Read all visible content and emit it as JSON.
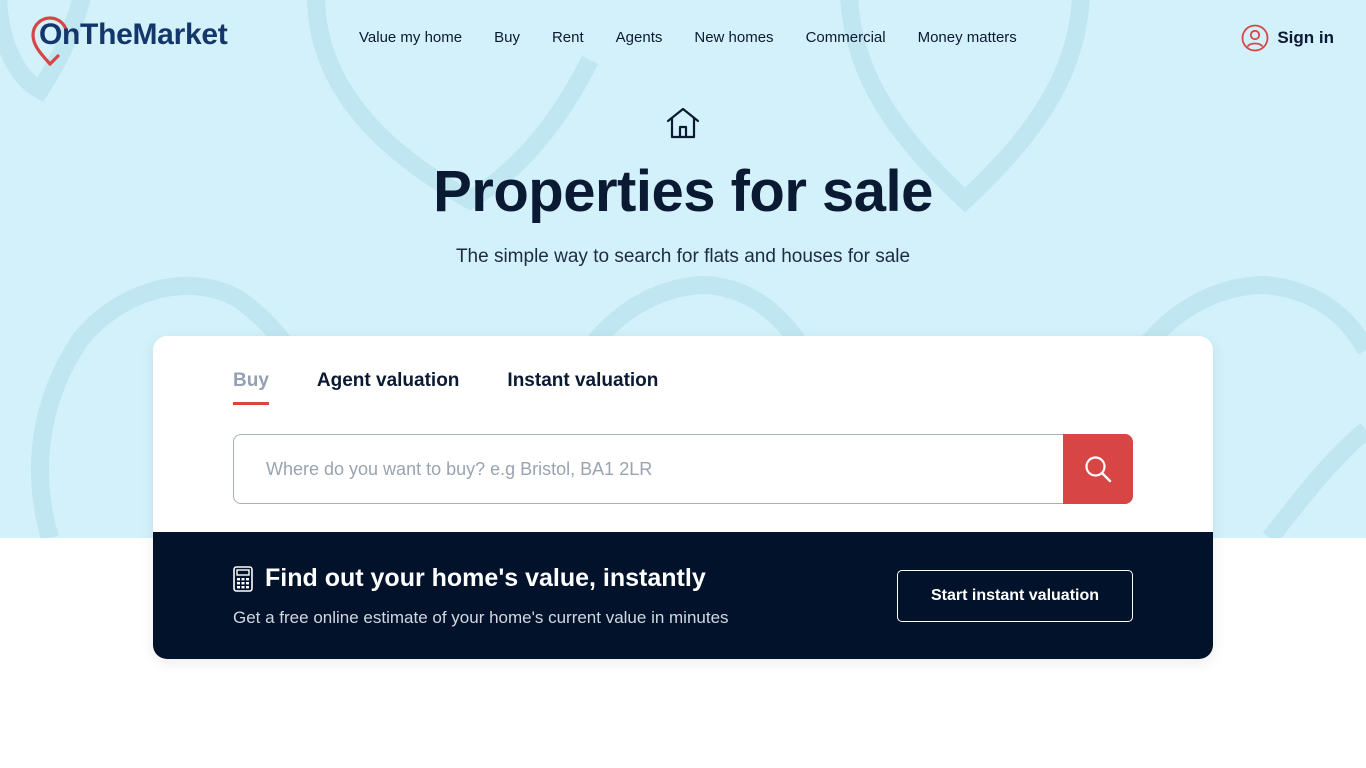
{
  "brand": {
    "name": "OnTheMarket",
    "accent_color": "#d74544",
    "navy_color": "#0b1a33",
    "hero_bg_color": "#d3f1fa",
    "logo_text_color": "#13366b"
  },
  "nav": {
    "items": [
      {
        "label": "Value my home"
      },
      {
        "label": "Buy"
      },
      {
        "label": "Rent"
      },
      {
        "label": "Agents"
      },
      {
        "label": "New homes"
      },
      {
        "label": "Commercial"
      },
      {
        "label": "Money matters"
      }
    ],
    "signin_label": "Sign in",
    "signin_icon": "user-circle-icon"
  },
  "hero": {
    "icon": "house-icon",
    "title": "Properties for sale",
    "subtitle": "The simple way to search for flats and houses for sale"
  },
  "search_card": {
    "tabs": [
      {
        "label": "Buy",
        "active": true
      },
      {
        "label": "Agent valuation",
        "active": false
      },
      {
        "label": "Instant valuation",
        "active": false
      }
    ],
    "search": {
      "placeholder": "Where do you want to buy? e.g Bristol, BA1 2LR",
      "value": "",
      "button_icon": "search-icon"
    }
  },
  "valuation": {
    "icon": "calculator-icon",
    "title": "Find out your home's value, instantly",
    "subtitle": "Get a free online estimate of your home's current value in minutes",
    "button_label": "Start instant valuation",
    "bg_color": "#02122b"
  }
}
